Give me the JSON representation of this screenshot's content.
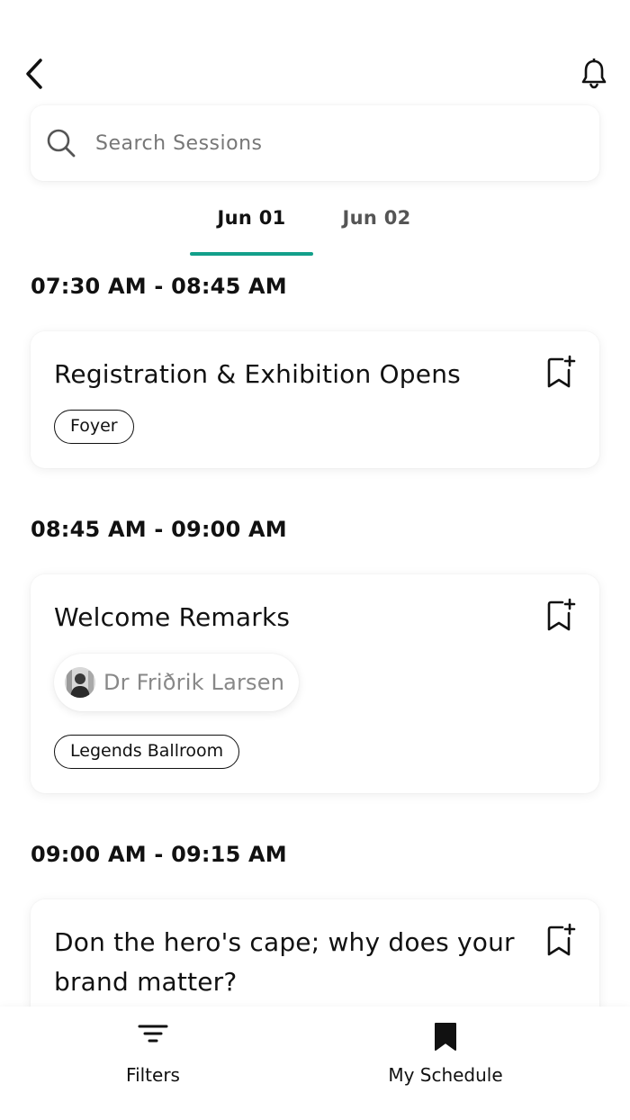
{
  "search": {
    "placeholder": "Search Sessions"
  },
  "tabs": [
    {
      "label": "Jun 01",
      "active": true
    },
    {
      "label": "Jun 02",
      "active": false
    }
  ],
  "accent_color": "#12a08a",
  "sessions": [
    {
      "time": "07:30 AM -  08:45 AM",
      "title": "Registration & Exhibition Opens",
      "location": "Foyer"
    },
    {
      "time": "08:45 AM -  09:00 AM",
      "title": "Welcome Remarks",
      "speaker": "Dr Friðrik Larsen",
      "location": "Legends Ballroom"
    },
    {
      "time": "09:00 AM -  09:15 AM",
      "title": "Don the hero's cape; why does your brand matter?"
    }
  ],
  "icons": {
    "back": "chevron-left-icon",
    "notifications": "bell-icon",
    "search": "search-icon",
    "bookmark": "bookmark-plus-icon",
    "filters": "filter-icon",
    "schedule": "bookmark-icon"
  },
  "bottom_nav": {
    "filters_label": "Filters",
    "schedule_label": "My Schedule"
  }
}
